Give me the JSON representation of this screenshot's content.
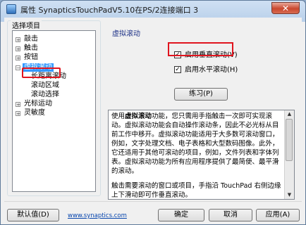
{
  "window": {
    "title": "属性 SynapticsTouchPadV5.10在PS/2连接端口 3",
    "close_label": "✕"
  },
  "tree": {
    "legend": "选择项目",
    "items": [
      {
        "label": "敲击",
        "expander": "+"
      },
      {
        "label": "触击",
        "expander": "+"
      },
      {
        "label": "按钮",
        "expander": "+"
      },
      {
        "label": "虚拟滚动",
        "expander": "−"
      },
      {
        "label": "长距离滚动",
        "expander": ""
      },
      {
        "label": "滚动区域",
        "expander": ""
      },
      {
        "label": "滚动选择",
        "expander": ""
      },
      {
        "label": "光标运动",
        "expander": "+"
      },
      {
        "label": "灵敏度",
        "expander": "+"
      }
    ]
  },
  "panel": {
    "title": "虚拟滚动",
    "checkbox_vertical": {
      "label": "启用垂直滚动(V)",
      "checked": "✓"
    },
    "checkbox_horizontal": {
      "label": "启用水平滚动(H)",
      "checked": "✓"
    },
    "practice_button": "练习(P)"
  },
  "description": {
    "p1_bold": "虚拟滚动",
    "p1_pre": "使用",
    "p1_post": "功能，您只需用手指触击一次即可实现滚动。虚拟滚动功能会自动操作滚动条，因此不必光标从目前工作中移开。虚拟滚动功能适用于大多数可滚动窗口，例如，文字处理文档、电子表格和大型数码图像。此外，它还适用于其他可滚动的项目，例如，文件列表和字体列表。虚拟滚动功能为所有应用程序提供了最简便、最平滑的滚动。",
    "p2": "触击需要滚动的窗口或项目，手指沿 TouchPad 右侧边缘上下滑动即可作垂直滚动。"
  },
  "footer": {
    "defaults_button": "默认值(D)",
    "link": "www.synaptics.com",
    "ok_button": "确定",
    "cancel_button": "取消",
    "apply_button": "应用(A)"
  },
  "colors": {
    "highlight_border": "#e0141e",
    "selection": "#3399ff",
    "link": "#0645ad"
  }
}
